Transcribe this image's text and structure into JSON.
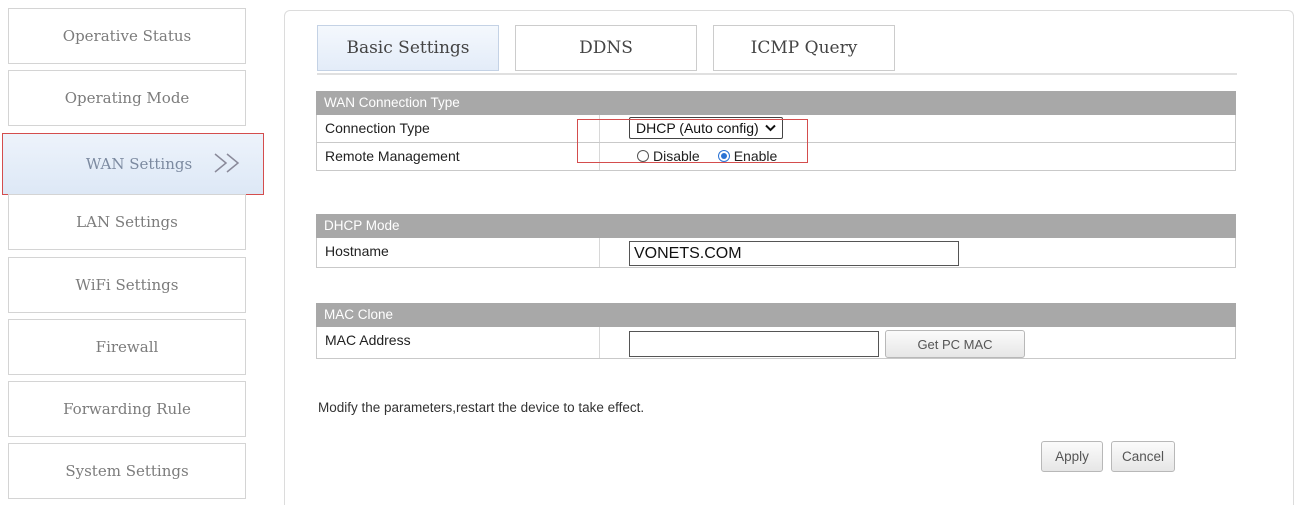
{
  "sidebar": {
    "items": [
      {
        "label": "Operative Status"
      },
      {
        "label": "Operating Mode"
      },
      {
        "label": "WAN Settings",
        "active": true,
        "arrow": "double-chevron-right-icon"
      },
      {
        "label": "LAN Settings"
      },
      {
        "label": "WiFi Settings"
      },
      {
        "label": "Firewall"
      },
      {
        "label": "Forwarding Rule"
      },
      {
        "label": "System Settings"
      }
    ]
  },
  "tabs": [
    {
      "label": "Basic Settings",
      "active": true
    },
    {
      "label": "DDNS"
    },
    {
      "label": "ICMP Query"
    }
  ],
  "wan": {
    "header": "WAN Connection Type",
    "connection_type_label": "Connection Type",
    "connection_type_value": "DHCP (Auto config)",
    "remote_management_label": "Remote Management",
    "disable_label": "Disable",
    "enable_label": "Enable",
    "remote_management_selected": "Enable"
  },
  "dhcp": {
    "header": "DHCP Mode",
    "hostname_label": "Hostname",
    "hostname_value": "VONETS.COM"
  },
  "mac": {
    "header": "MAC Clone",
    "address_label": "MAC Address",
    "address_value": "",
    "get_pc_mac_label": "Get PC MAC"
  },
  "note": "Modify the parameters,restart the device to take effect.",
  "actions": {
    "apply_label": "Apply",
    "cancel_label": "Cancel"
  },
  "colors": {
    "highlight": "#d44d4d",
    "section_header": "#a8a8a8",
    "radio_checked": "#2b73d4"
  }
}
